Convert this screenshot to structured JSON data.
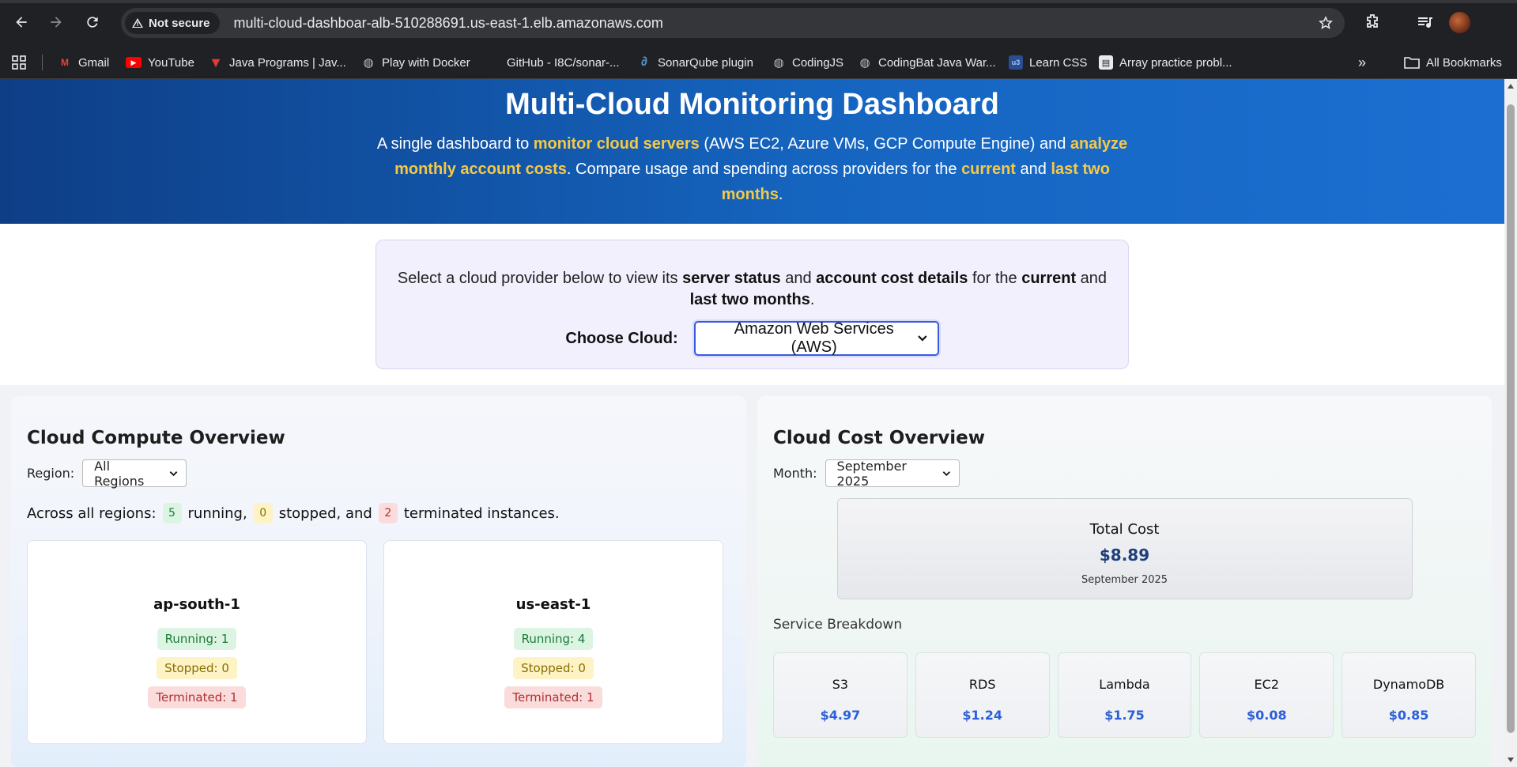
{
  "browser": {
    "security_label": "Not secure",
    "url": "multi-cloud-dashboar-alb-510288691.us-east-1.elb.amazonaws.com",
    "bookmarks": [
      {
        "label": "Gmail",
        "icon": "gmail-icon"
      },
      {
        "label": "YouTube",
        "icon": "youtube-icon"
      },
      {
        "label": "Java Programs | Jav...",
        "icon": "java-programs-icon"
      },
      {
        "label": "Play with Docker",
        "icon": "globe-icon"
      },
      {
        "label": "GitHub - I8C/sonar-...",
        "icon": "github-icon"
      },
      {
        "label": "SonarQube plugin",
        "icon": "sonarqube-icon"
      },
      {
        "label": "CodingJS",
        "icon": "globe-icon"
      },
      {
        "label": "CodingBat Java War...",
        "icon": "globe-icon"
      },
      {
        "label": "Learn CSS",
        "icon": "learn-css-icon"
      },
      {
        "label": "Array practice probl...",
        "icon": "doc-icon"
      }
    ],
    "all_bookmarks_label": "All Bookmarks"
  },
  "hero": {
    "title": "Multi-Cloud Monitoring Dashboard",
    "desc_1": "A single dashboard to ",
    "desc_hl_1": "monitor cloud servers",
    "desc_2": " (AWS EC2, Azure VMs, GCP Compute Engine) and ",
    "desc_hl_2": "analyze monthly account costs",
    "desc_3": ". Compare usage and spending across providers for the ",
    "desc_hl_3": "current",
    "desc_4": " and ",
    "desc_hl_4": "last two months",
    "desc_5": "."
  },
  "selector": {
    "intro_1": "Select a cloud provider below to view its ",
    "intro_b1": "server status",
    "intro_2": " and ",
    "intro_b2": "account cost details",
    "intro_3": " for the ",
    "intro_b3": "current",
    "intro_4": " and ",
    "intro_b4": "last two months",
    "intro_5": ".",
    "choose_label": "Choose Cloud:",
    "selected_cloud": "Amazon Web Services (AWS)"
  },
  "compute": {
    "title": "Cloud Compute Overview",
    "region_label": "Region:",
    "region_selected": "All Regions",
    "summary_prefix": "Across all regions:",
    "running": "5",
    "running_label": "running,",
    "stopped": "0",
    "stopped_label": "stopped, and",
    "terminated": "2",
    "terminated_label": "terminated instances.",
    "regions": [
      {
        "name": "ap-south-1",
        "running": "Running: 1",
        "stopped": "Stopped: 0",
        "terminated": "Terminated: 1"
      },
      {
        "name": "us-east-1",
        "running": "Running: 4",
        "stopped": "Stopped: 0",
        "terminated": "Terminated: 1"
      }
    ]
  },
  "cost": {
    "title": "Cloud Cost Overview",
    "month_label": "Month:",
    "month_selected": "September 2025",
    "total_label": "Total Cost",
    "total_value": "$8.89",
    "total_month": "September 2025",
    "breakdown_title": "Service Breakdown",
    "services": [
      {
        "name": "S3",
        "cost": "$4.97"
      },
      {
        "name": "RDS",
        "cost": "$1.24"
      },
      {
        "name": "Lambda",
        "cost": "$1.75"
      },
      {
        "name": "EC2",
        "cost": "$0.08"
      },
      {
        "name": "DynamoDB",
        "cost": "$0.85"
      }
    ]
  },
  "colors": {
    "hero_blue": "#1565c0",
    "highlight_yellow": "#f6c945",
    "running_green": "#1d7a3a",
    "stopped_yellow": "#8a6d00",
    "terminated_red": "#b03030",
    "cost_blue": "#2b5fd9"
  }
}
